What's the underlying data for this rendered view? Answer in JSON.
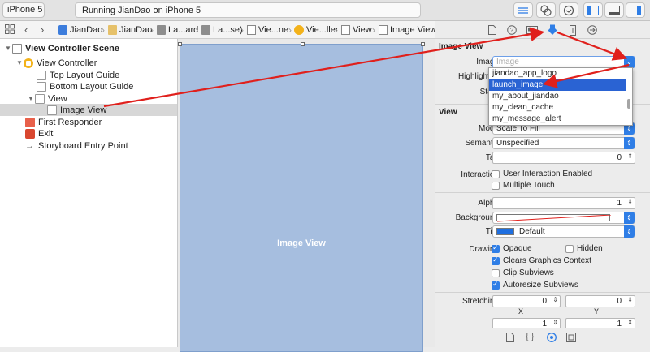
{
  "toolbar": {
    "scheme": "iPhone 5",
    "status": "Running JianDao on iPhone 5"
  },
  "jumpbar": {
    "crumbs": [
      "JianDao",
      "JianDao",
      "La...ard",
      "La...se)",
      "Vie...ne",
      "Vie...ller",
      "View",
      "Image View"
    ]
  },
  "outline": {
    "scene": "View Controller Scene",
    "view_controller": "View Controller",
    "top_guide": "Top Layout Guide",
    "bottom_guide": "Bottom Layout Guide",
    "view": "View",
    "image_view": "Image View",
    "first_responder": "First Responder",
    "exit": "Exit",
    "entry_point": "Storyboard Entry Point"
  },
  "canvas": {
    "image_view_label": "Image View"
  },
  "inspector": {
    "image_view_section": "Image View",
    "image_label": "Image",
    "image_placeholder": "Image",
    "highlighted_label": "Highlighted",
    "state_label": "State",
    "dropdown_items": [
      "jiandao_app_logo",
      "launch_image",
      "my_about_jiandao",
      "my_clean_cache",
      "my_message_alert"
    ],
    "dropdown_selected": "launch_image",
    "view_section": "View",
    "mode_label": "Mode",
    "mode_value": "Scale To Fill",
    "semantic_label": "Semantic",
    "semantic_value": "Unspecified",
    "tag_label": "Tag",
    "tag_value": "0",
    "interaction_label": "Interaction",
    "user_interaction": "User Interaction Enabled",
    "multiple_touch": "Multiple Touch",
    "alpha_label": "Alpha",
    "alpha_value": "1",
    "background_label": "Background",
    "tint_label": "Tint",
    "tint_value": "Default",
    "tint_color": "#1f6fe0",
    "drawing_label": "Drawing",
    "opaque": "Opaque",
    "hidden": "Hidden",
    "clears_graphics": "Clears Graphics Context",
    "clip_subviews": "Clip Subviews",
    "autoresize": "Autoresize Subviews",
    "stretching_label": "Stretching",
    "stretch_x_value": "0",
    "stretch_y_value": "0",
    "stretch_x_label": "X",
    "stretch_y_label": "Y",
    "stretch_w_value": "1",
    "stretch_h_value": "1"
  },
  "accent_color": "#2f7ee6",
  "arrow_color": "#e0201c"
}
